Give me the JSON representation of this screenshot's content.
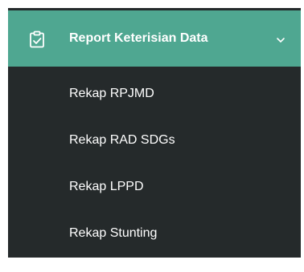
{
  "colors": {
    "sidebar_bg": "#252a2b",
    "active_bg": "#4fa791",
    "text": "#ffffff"
  },
  "menu": {
    "header": {
      "label": "Report Keterisian Data",
      "icon": "clipboard-check-icon",
      "chevron_icon": "chevron-down-icon",
      "expanded": true
    },
    "items": [
      {
        "label": "Rekap RPJMD"
      },
      {
        "label": "Rekap RAD SDGs"
      },
      {
        "label": "Rekap LPPD"
      },
      {
        "label": "Rekap Stunting"
      }
    ]
  }
}
